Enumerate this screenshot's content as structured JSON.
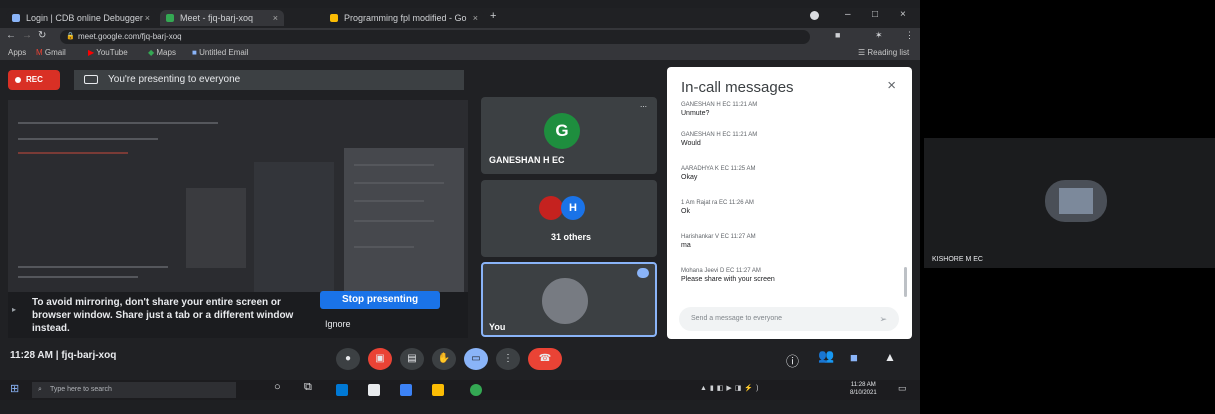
{
  "browser": {
    "tabs": [
      {
        "label": "Login | CDB online Debugger"
      },
      {
        "label": "Meet - fjq-barj-xoq"
      },
      {
        "label": "Programming fpl modified - Go"
      }
    ],
    "url": "meet.google.com/fjq-barj-xoq",
    "bookmarks": {
      "apps": "Apps",
      "gmail": "Gmail",
      "youtube": "YouTube",
      "maps": "Maps",
      "untitled": "Untitled Email",
      "reading_list": "Reading list"
    }
  },
  "meet": {
    "rec_label": "REC",
    "presenting_banner": "You're presenting to everyone",
    "mirror_warning": "To avoid mirroring, don't share your entire screen or browser window. Share just a tab or a different window instead.",
    "stop_presenting_label": "Stop presenting",
    "ignore_label": "Ignore",
    "participants": {
      "tile1": {
        "initial": "G",
        "name": "GANESHAN H EC",
        "color": "#1e8e3e"
      },
      "tile2": {
        "initial": "H",
        "label": "31 others",
        "color": "#1a73e8"
      },
      "tile3": {
        "name": "You"
      }
    },
    "meeting_info": "11:28 AM | fjq-barj-xoq",
    "end_call_color": "#ea4335",
    "controls": [
      "mic-icon",
      "camera-off-icon",
      "captions-icon",
      "raise-hand-icon",
      "present-icon",
      "more-options-icon",
      "end-call-icon"
    ]
  },
  "chat": {
    "title": "In-call messages",
    "close": "×",
    "messages": [
      {
        "meta": "GANESHAN H EC   11:21 AM",
        "body": "Unmute?"
      },
      {
        "meta": "GANESHAN H EC   11:21 AM",
        "body": "Would"
      },
      {
        "meta": "AARADHYA K EC   11:25 AM",
        "body": "Okay"
      },
      {
        "meta": "1 Am Rajat ra EC   11:26 AM",
        "body": "Ok"
      },
      {
        "meta": "Harishankar V EC   11:27 AM",
        "body": "ma"
      },
      {
        "meta": "Mohana Jeevi D EC   11:27 AM",
        "body": "Please share with your screen"
      }
    ],
    "input_placeholder": "Send a message to everyone",
    "send": "➢"
  },
  "taskbar": {
    "search_placeholder": "Type here to search",
    "time": "11:28 AM",
    "date": "8/10/2021"
  },
  "right_tile": {
    "name": "KISHORE M EC"
  }
}
